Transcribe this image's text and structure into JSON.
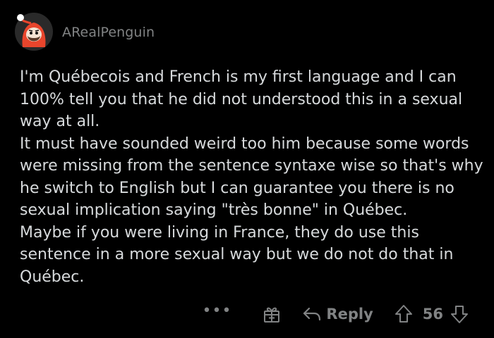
{
  "comment": {
    "author": "ARealPenguin",
    "avatar": "snoo-avatar-red-hood",
    "paragraphs": [
      "I'm Québecois and French is my first language and I can 100% tell you that he did not understood this in a sexual way at all.",
      "It must have sounded weird too him because some words were missing from the sentence syntaxe wise so that's why he switch to English but I can guarantee you there is no sexual implication saying \"très bonne\" in Québec.",
      "Maybe if you were living in France, they do use this sentence in a more sexual way but we do not do that in Québec."
    ],
    "actions": {
      "more_label": "•••",
      "award_icon": "gift-icon",
      "reply_icon": "reply-arrow-icon",
      "reply_label": "Reply",
      "upvote_icon": "upvote-arrow-icon",
      "score": "56",
      "downvote_icon": "downvote-arrow-icon"
    }
  },
  "colors": {
    "background": "#000000",
    "body_text": "#d7dadc",
    "meta_text": "#818384",
    "avatar_red": "#e8452c"
  }
}
